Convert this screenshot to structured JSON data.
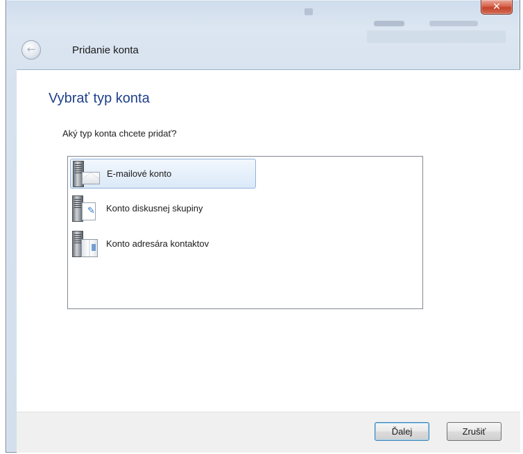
{
  "window": {
    "title": "Pridanie konta",
    "close_glyph": "✕"
  },
  "back": {
    "icon": "back-arrow-icon",
    "glyph": "←"
  },
  "page": {
    "heading": "Vybrať typ konta",
    "question": "Aký typ konta chcete pridať?"
  },
  "account_types": [
    {
      "label": "E-mailové konto",
      "icon": "email-account-icon",
      "selected": true
    },
    {
      "label": "Konto diskusnej skupiny",
      "icon": "newsgroup-account-icon",
      "selected": false
    },
    {
      "label": "Konto adresára kontaktov",
      "icon": "directory-account-icon",
      "selected": false
    }
  ],
  "footer": {
    "next_label": "Ďalej",
    "cancel_label": "Zrušiť"
  },
  "colors": {
    "heading": "#1e3f8a",
    "selection_border": "#8fb2dc",
    "close_button": "#c4432c"
  }
}
